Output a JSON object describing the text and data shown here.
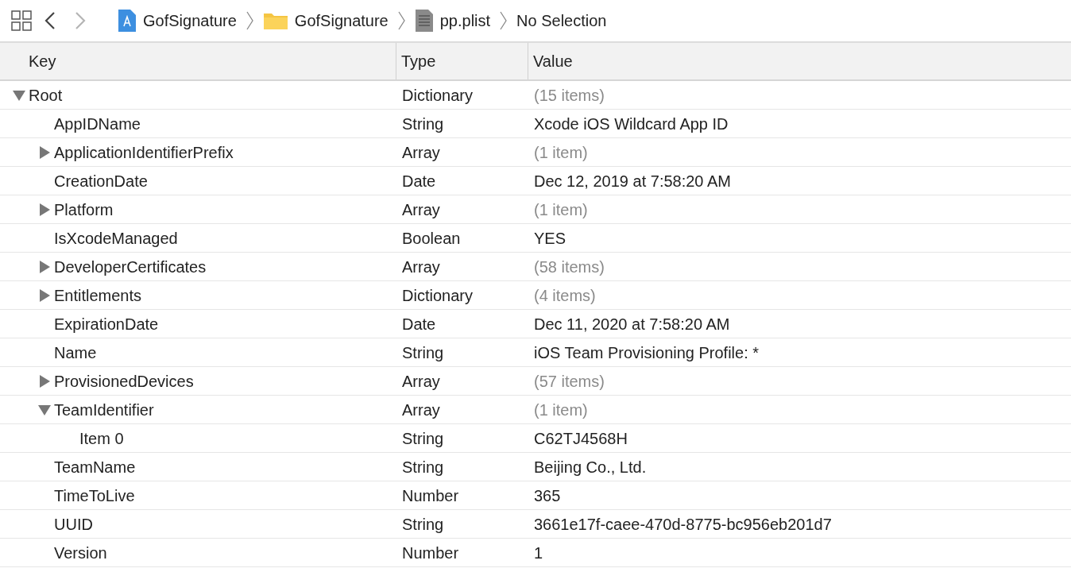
{
  "toolbar": {
    "back": {
      "disabled": false
    },
    "forward": {
      "disabled": true
    }
  },
  "breadcrumb": [
    {
      "label": "GofSignature",
      "kind": "project"
    },
    {
      "label": "GofSignature",
      "kind": "folder"
    },
    {
      "label": "pp.plist",
      "kind": "file"
    },
    {
      "label": "No Selection",
      "kind": "text"
    }
  ],
  "table": {
    "columns": [
      "Key",
      "Type",
      "Value"
    ],
    "rows": [
      {
        "key": "Root",
        "type": "Dictionary",
        "value": "(15 items)",
        "muted": true,
        "expanded": true,
        "children": [
          {
            "key": "AppIDName",
            "type": "String",
            "value": "Xcode iOS Wildcard App ID",
            "muted": false
          },
          {
            "key": "ApplicationIdentifierPrefix",
            "type": "Array",
            "value": "(1 item)",
            "muted": true,
            "expanded": false
          },
          {
            "key": "CreationDate",
            "type": "Date",
            "value": "Dec 12, 2019 at 7:58:20 AM",
            "muted": false
          },
          {
            "key": "Platform",
            "type": "Array",
            "value": "(1 item)",
            "muted": true,
            "expanded": false
          },
          {
            "key": "IsXcodeManaged",
            "type": "Boolean",
            "value": "YES",
            "muted": false
          },
          {
            "key": "DeveloperCertificates",
            "type": "Array",
            "value": "(58 items)",
            "muted": true,
            "expanded": false
          },
          {
            "key": "Entitlements",
            "type": "Dictionary",
            "value": "(4 items)",
            "muted": true,
            "expanded": false
          },
          {
            "key": "ExpirationDate",
            "type": "Date",
            "value": "Dec 11, 2020 at 7:58:20 AM",
            "muted": false
          },
          {
            "key": "Name",
            "type": "String",
            "value": "iOS Team Provisioning Profile: *",
            "muted": false
          },
          {
            "key": "ProvisionedDevices",
            "type": "Array",
            "value": "(57 items)",
            "muted": true,
            "expanded": false
          },
          {
            "key": "TeamIdentifier",
            "type": "Array",
            "value": "(1 item)",
            "muted": true,
            "expanded": true,
            "children": [
              {
                "key": "Item 0",
                "type": "String",
                "value": "C62TJ4568H",
                "muted": false
              }
            ]
          },
          {
            "key": "TeamName",
            "type": "String",
            "value": "Beijing  Co., Ltd.",
            "muted": false
          },
          {
            "key": "TimeToLive",
            "type": "Number",
            "value": "365",
            "muted": false
          },
          {
            "key": "UUID",
            "type": "String",
            "value": "3661e17f-caee-470d-8775-bc956eb201d7",
            "muted": false
          },
          {
            "key": "Version",
            "type": "Number",
            "value": "1",
            "muted": false
          }
        ]
      }
    ]
  }
}
